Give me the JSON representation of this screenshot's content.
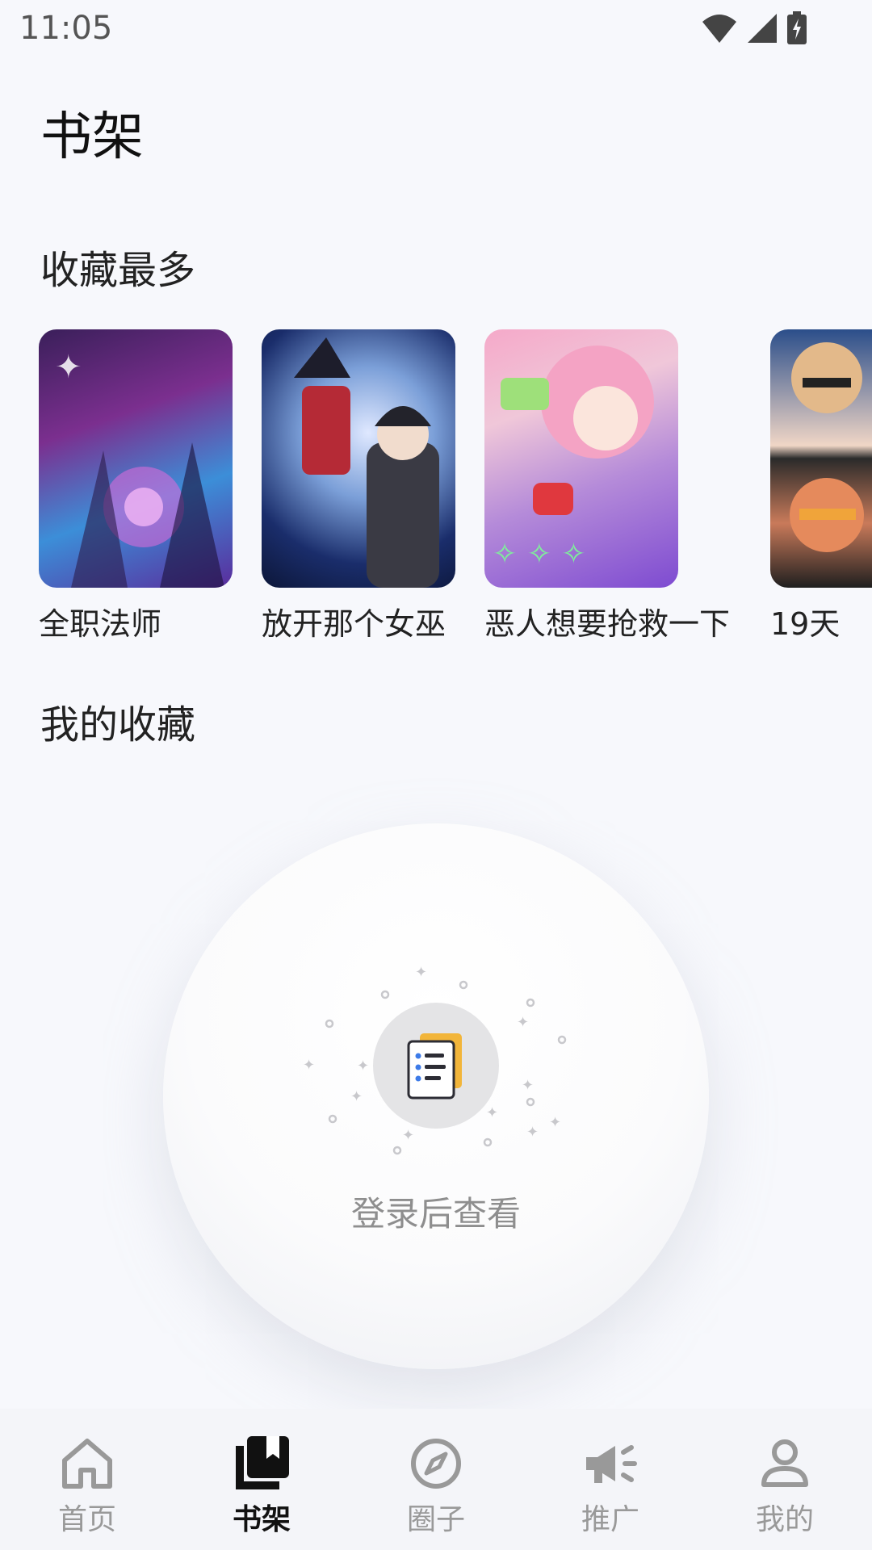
{
  "status": {
    "time": "11:05"
  },
  "page": {
    "title": "书架"
  },
  "sections": {
    "most_collected": "收藏最多",
    "my_collection": "我的收藏"
  },
  "books": [
    {
      "title": "全职法师"
    },
    {
      "title": "放开那个女巫"
    },
    {
      "title": "恶人想要抢救一下"
    },
    {
      "title": "19天"
    }
  ],
  "empty_state": {
    "message": "登录后查看"
  },
  "nav": {
    "items": [
      {
        "label": "首页",
        "icon": "home-icon"
      },
      {
        "label": "书架",
        "icon": "bookshelf-icon",
        "active": true
      },
      {
        "label": "圈子",
        "icon": "compass-icon"
      },
      {
        "label": "推广",
        "icon": "megaphone-icon"
      },
      {
        "label": "我的",
        "icon": "person-icon"
      }
    ]
  },
  "colors": {
    "background": "#f7f8fc",
    "nav_active": "#111111",
    "nav_inactive": "#999999"
  }
}
